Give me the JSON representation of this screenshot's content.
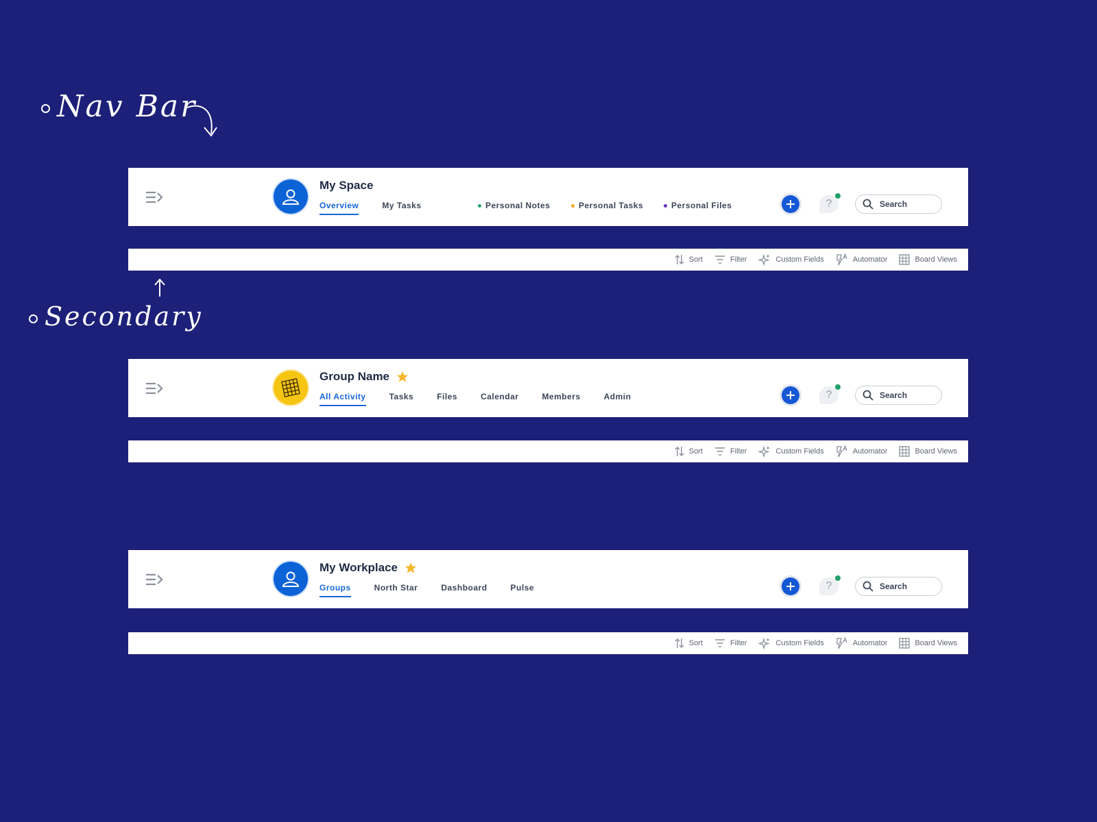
{
  "annotations": {
    "nav_bar": "Nav Bar",
    "secondary": "Secondary"
  },
  "colors": {
    "background": "#1d2078",
    "accent": "#1565d8",
    "star": "#f5b82e",
    "online": "#22a06b"
  },
  "bars": [
    {
      "title": "My Space",
      "avatar_icon": "user-icon",
      "starred": false,
      "tabs": [
        {
          "label": "Overview",
          "active": true
        },
        {
          "label": "My Tasks",
          "active": false
        }
      ],
      "personal_links": [
        {
          "label": "Personal Notes",
          "dot_color": "#22a06b"
        },
        {
          "label": "Personal Tasks",
          "dot_color": "#f5a623"
        },
        {
          "label": "Personal Files",
          "dot_color": "#6b2fc9"
        }
      ],
      "search_label": "Search",
      "help_label": "?"
    },
    {
      "title": "Group Name",
      "avatar_icon": "grid-icon",
      "starred": true,
      "tabs": [
        {
          "label": "All Activity",
          "active": true
        },
        {
          "label": "Tasks",
          "active": false
        },
        {
          "label": "Files",
          "active": false
        },
        {
          "label": "Calendar",
          "active": false
        },
        {
          "label": "Members",
          "active": false
        },
        {
          "label": "Admin",
          "active": false
        }
      ],
      "search_label": "Search",
      "help_label": "?"
    },
    {
      "title": "My Workplace",
      "avatar_icon": "user-icon",
      "starred": true,
      "tabs": [
        {
          "label": "Groups",
          "active": true
        },
        {
          "label": "North Star",
          "active": false
        },
        {
          "label": "Dashboard",
          "active": false
        },
        {
          "label": "Pulse",
          "active": false
        }
      ],
      "search_label": "Search",
      "help_label": "?"
    }
  ],
  "secondary": {
    "sort": "Sort",
    "filter": "Filter",
    "custom_fields": "Custom Fields",
    "automator": "Automator",
    "board_views": "Board Views"
  }
}
